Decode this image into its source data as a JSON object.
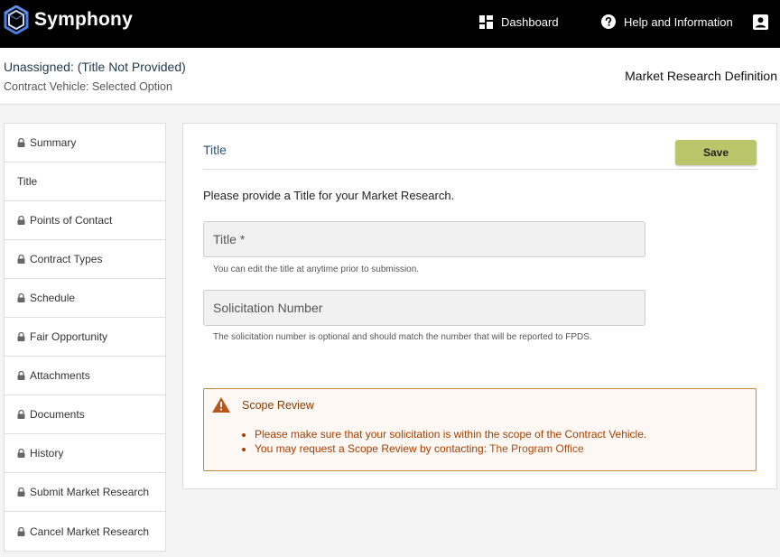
{
  "app": {
    "name": "Symphony"
  },
  "nav": {
    "dashboard": "Dashboard",
    "help": "Help and Information"
  },
  "header": {
    "title": "Unassigned: (Title Not Provided)",
    "subtitle": "Contract Vehicle: Selected Option",
    "section": "Market Research Definition"
  },
  "sidebar": {
    "items": [
      {
        "label": "Summary",
        "locked": true
      },
      {
        "label": "Title",
        "locked": false
      },
      {
        "label": "Points of Contact",
        "locked": true
      },
      {
        "label": "Contract Types",
        "locked": true
      },
      {
        "label": "Schedule",
        "locked": true
      },
      {
        "label": "Fair Opportunity",
        "locked": true
      },
      {
        "label": "Attachments",
        "locked": true
      },
      {
        "label": "Documents",
        "locked": true
      },
      {
        "label": "History",
        "locked": true
      },
      {
        "label": "Submit Market Research",
        "locked": true
      },
      {
        "label": "Cancel Market Research",
        "locked": true
      }
    ]
  },
  "panel": {
    "title": "Title",
    "save_label": "Save",
    "intro": "Please provide a Title for your Market Research.",
    "title_field": {
      "value": "",
      "placeholder": "Title *",
      "help": "You can edit the title at anytime prior to submission."
    },
    "solicitation_field": {
      "value": "",
      "placeholder": "Solicitation Number",
      "help": "The solicitation number is optional and should match the number that will be reported to FPDS."
    },
    "alert": {
      "title": "Scope Review",
      "line1": "Please make sure that your solicitation is within the scope of the Contract Vehicle.",
      "line2_prefix": "You may request a Scope Review by contacting: ",
      "line2_link": "The Program Office"
    }
  },
  "colors": {
    "topbar": "#000000",
    "save_button": "#b9c76a",
    "alert_border": "#c6883f",
    "alert_text": "#a33e00",
    "panel_title": "#2b5670"
  }
}
